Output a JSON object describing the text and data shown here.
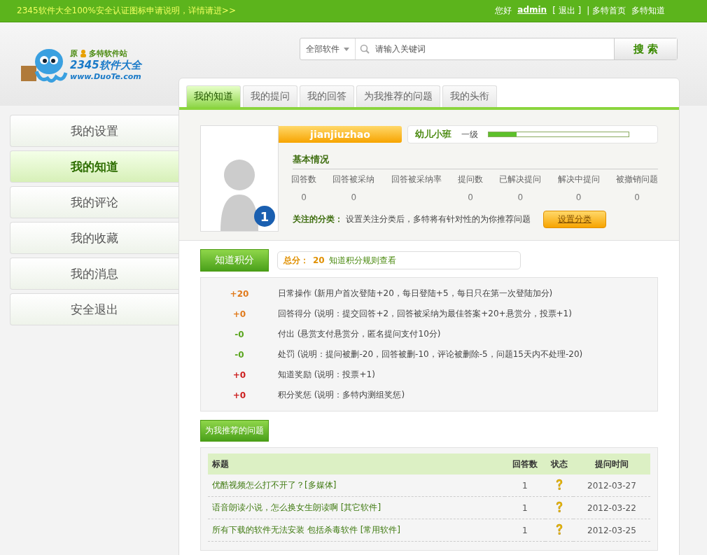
{
  "topbar": {
    "notice": "2345软件大全100%安全认证图标申请说明，详情请进>>",
    "greeting": "您好",
    "username": "admin",
    "logout": "[ 退出 ]",
    "links": [
      "| 多特首页",
      "多特知道"
    ]
  },
  "logo": {
    "line1": "原",
    "line1b": "多特软件站",
    "line2": "2345软件大全",
    "line3": "www.DuoTe.com"
  },
  "search": {
    "category": "全部软件",
    "placeholder": "请输入关键词",
    "button": "搜 索"
  },
  "sidebar": {
    "items": [
      {
        "label": "我的设置",
        "selected": false
      },
      {
        "label": "我的知道",
        "selected": true
      },
      {
        "label": "我的评论",
        "selected": false
      },
      {
        "label": "我的收藏",
        "selected": false
      },
      {
        "label": "我的消息",
        "selected": false
      },
      {
        "label": "安全退出",
        "selected": false
      }
    ]
  },
  "tabs": [
    {
      "label": "我的知道",
      "selected": true
    },
    {
      "label": "我的提问",
      "selected": false
    },
    {
      "label": "我的回答",
      "selected": false
    },
    {
      "label": "为我推荐的问题",
      "selected": false
    },
    {
      "label": "我的头衔",
      "selected": false
    }
  ],
  "profile": {
    "badge": "1",
    "name": "jianjiuzhao",
    "rank": "幼儿小班",
    "grade": "一级",
    "level": 0.2,
    "basic_title": "基本情况",
    "stats": [
      {
        "label": "回答数",
        "value": "0"
      },
      {
        "label": "回答被采纳",
        "value": "0"
      },
      {
        "label": "回答被采纳率"
      },
      {
        "label": "提问数",
        "value": "0"
      },
      {
        "label": "已解决提问",
        "value": "0"
      },
      {
        "label": "解决中提问",
        "value": "0"
      },
      {
        "label": "被撤销问题",
        "value": "0"
      }
    ],
    "follow_label": "关注的分类：",
    "follow_text": "设置关注分类后，多特将有针对性的为你推荐问题",
    "follow_button": "设置分类"
  },
  "points": {
    "heading": "知道积分",
    "total_label": "总分：",
    "total": "20",
    "rules_link": "知道积分规则查看",
    "rows": [
      {
        "value": "+20",
        "color": "#e07a1c",
        "text": "日常操作 (新用户首次登陆+20，每日登陆+5，每日只在第一次登陆加分)"
      },
      {
        "value": "+0",
        "color": "#e07a1c",
        "text": "回答得分 (说明：提交回答+2，回答被采纳为最佳答案+20+悬赏分，投票+1)"
      },
      {
        "value": "-0",
        "color": "#5aa51e",
        "text": "付出 (悬赏支付悬赏分，匿名提问支付10分)"
      },
      {
        "value": "-0",
        "color": "#5aa51e",
        "text": "处罚 (说明：提问被删-20，回答被删-10，评论被删除-5，问题15天内不处理-20)"
      },
      {
        "value": "+0",
        "color": "#cc1e1e",
        "text": "知道奖励 (说明：投票+1)"
      },
      {
        "value": "+0",
        "color": "#cc1e1e",
        "text": "积分奖惩 (说明：多特内测组奖惩)"
      }
    ]
  },
  "recommended": {
    "heading": "为我推荐的问题",
    "table": {
      "columns": [
        "标题",
        "回答数",
        "状态",
        "提问时间"
      ],
      "rows": [
        {
          "title": "优酷视频怎么打不开了？[多媒体]",
          "answers": "1",
          "date": "2012-03-27"
        },
        {
          "title": "语音朗读小说，怎么换女生朗读啊 [其它软件]",
          "answers": "1",
          "date": "2012-03-22"
        },
        {
          "title": "所有下载的软件无法安装 包括杀毒软件 [常用软件]",
          "answers": "1",
          "date": "2012-03-25"
        }
      ]
    }
  }
}
